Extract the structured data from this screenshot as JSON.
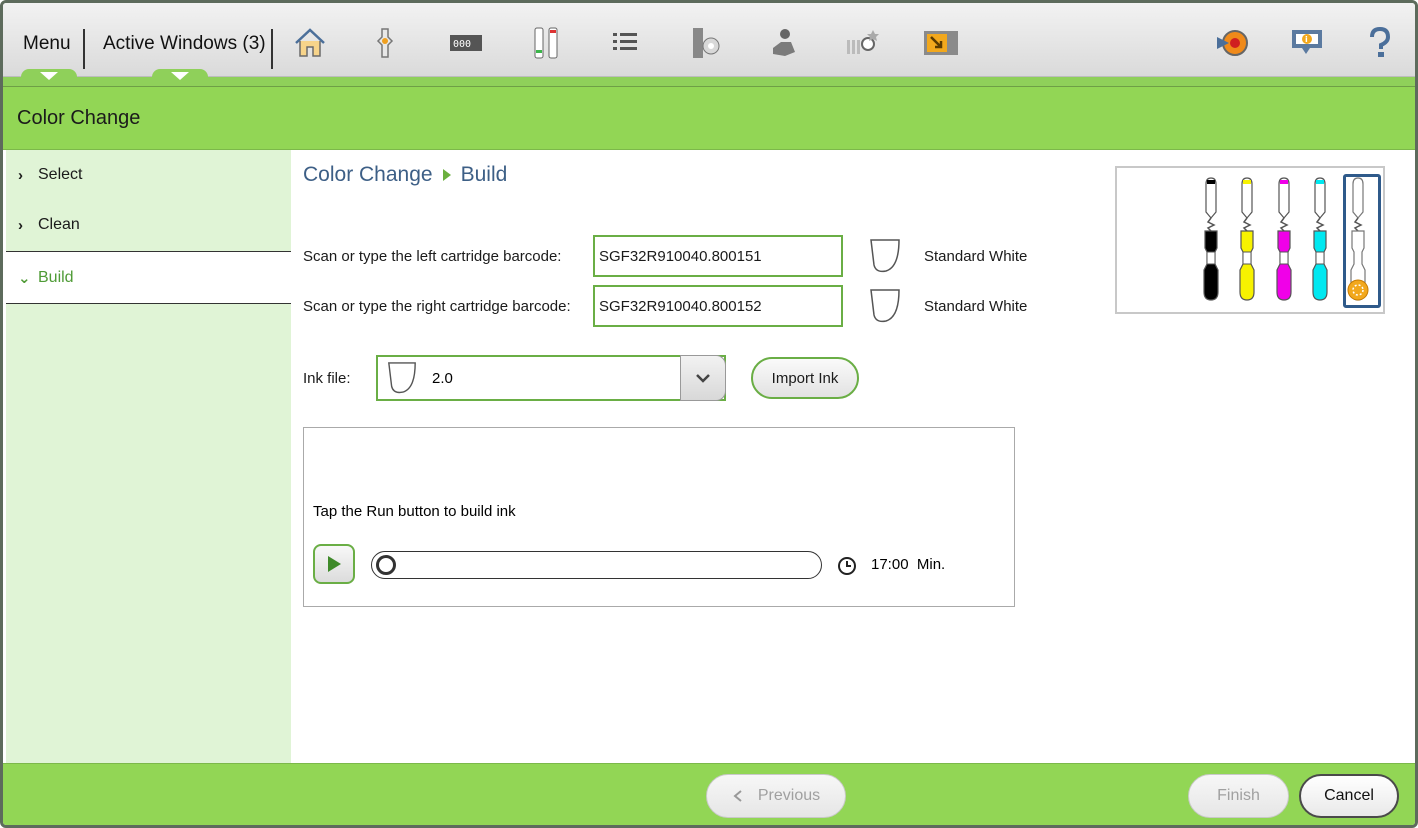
{
  "topbar": {
    "menu_label": "Menu",
    "active_windows_label": "Active Windows",
    "active_windows_count": "(3)",
    "icons": [
      "home-icon",
      "ink-transfer-icon",
      "counter-icon",
      "cartridge-levels-icon",
      "list-icon",
      "media-roll-icon",
      "printhead-service-icon",
      "ink-gauge-icon",
      "print-queue-icon",
      "support-icon",
      "info-icon",
      "help-icon"
    ]
  },
  "header": {
    "title": "Color Change"
  },
  "sidebar": {
    "items": [
      {
        "label": "Select",
        "state": "collapsed"
      },
      {
        "label": "Clean",
        "state": "collapsed"
      },
      {
        "label": "Build",
        "state": "active"
      }
    ]
  },
  "breadcrumb": {
    "parent": "Color Change",
    "current": "Build"
  },
  "form": {
    "left_label": "Scan or type the left cartridge barcode:",
    "left_value": "SGF32R910040.800151",
    "left_ink_name": "Standard White",
    "right_label": "Scan or type the right cartridge barcode:",
    "right_value": "SGF32R910040.800152",
    "right_ink_name": "Standard White",
    "ink_file_label": "Ink file:",
    "ink_file_value": "2.0",
    "import_label": "Import Ink"
  },
  "run": {
    "message": "Tap the Run button to build ink",
    "progress": 0,
    "time_value": "17:00",
    "time_unit": "Min."
  },
  "cartridges": [
    {
      "color": "#000000",
      "name": "black"
    },
    {
      "color": "#f7f200",
      "name": "yellow"
    },
    {
      "color": "#f000e8",
      "name": "magenta"
    },
    {
      "color": "#00e8f0",
      "name": "cyan"
    },
    {
      "color": "#ffffff",
      "name": "white"
    }
  ],
  "footer": {
    "previous_label": "Previous",
    "finish_label": "Finish",
    "cancel_label": "Cancel"
  },
  "colors": {
    "accent_green": "#92d655",
    "border_green": "#6aae45",
    "link_blue": "#3d5f86",
    "cartridge_select": "#2f5a8a"
  }
}
